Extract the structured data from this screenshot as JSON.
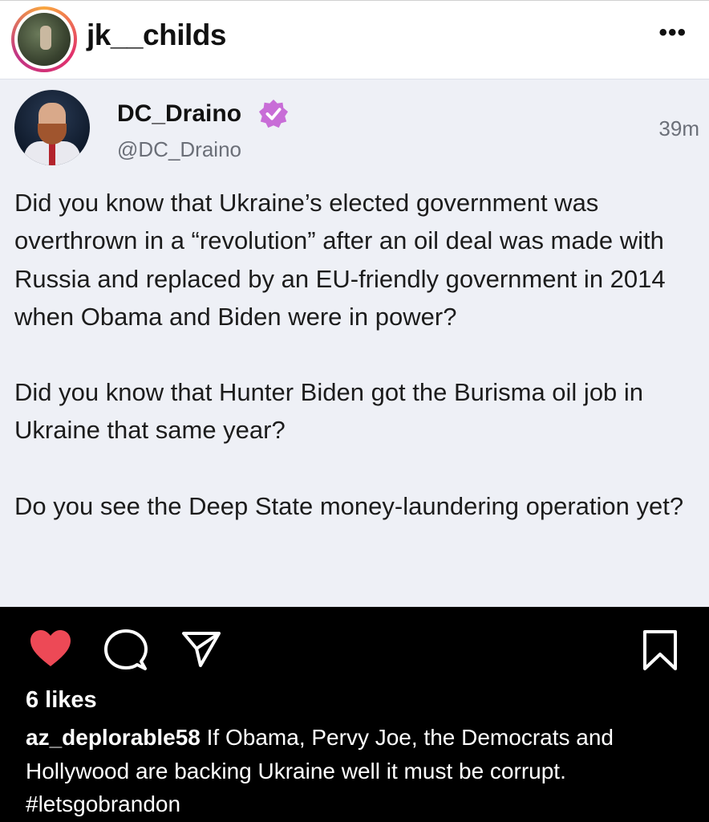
{
  "header": {
    "username": "jk__childs",
    "more_icon": "more-horizontal-icon"
  },
  "tweet": {
    "display_name": "DC_Draino",
    "handle": "@DC_Draino",
    "time": "39m",
    "verified_icon": "verified-badge-icon",
    "badge_color": "#c86dd7",
    "paragraphs": [
      "Did you know that Ukraine’s elected government was overthrown in a “revolution” after an oil deal was made with Russia and replaced by an EU-friendly government in 2014 when Obama and Biden were in power?",
      "Did you know that Hunter Biden got the Burisma oil job in Ukraine that same year?",
      "Do you see the Deep State money-laundering operation yet?"
    ]
  },
  "actions": {
    "like_icon": "heart-filled-icon",
    "like_color": "#ed4956",
    "comment_icon": "comment-icon",
    "share_icon": "send-icon",
    "save_icon": "bookmark-icon"
  },
  "post": {
    "likes": "6 likes",
    "caption_user": "az_deplorable58",
    "caption_text": " If Obama, Pervy Joe, the Democrats and Hollywood are backing Ukraine well it must be corrupt.",
    "hashtag": "#letsgobrandon"
  }
}
